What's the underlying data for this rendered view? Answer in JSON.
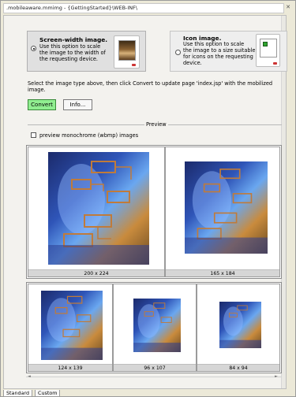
{
  "window": {
    "title": ".mobileaware.mmimg - {GettingStarted}\\WEB-INF\\"
  },
  "image_types": [
    {
      "title": "Screen-width image.",
      "description": [
        "Use this option to scale",
        "the image to the width of",
        "the requesting device."
      ],
      "selected": true
    },
    {
      "title": "Icon image.",
      "description": [
        "Use this option to scale",
        "the image to a size suitable",
        "for icons on the requesting",
        "device."
      ],
      "selected": false
    }
  ],
  "instruction": "Select the image type above, then click Convert to update page 'index.jsp' with the mobilized image.",
  "buttons": {
    "convert": "Convert",
    "info": "Info..."
  },
  "preview": {
    "label": "Preview",
    "monochrome_label": "preview monochrome (wbmp) images",
    "monochrome_checked": false,
    "sizes_row1": [
      "200 x 224",
      "165 x 184"
    ],
    "sizes_row2": [
      "124 x 139",
      "96 x 107",
      "84 x 94"
    ]
  },
  "tabs": [
    "Standard",
    "Custom"
  ],
  "colors": {
    "convert_button": "#90ee90",
    "panel_bg": "#f3f2ee"
  }
}
